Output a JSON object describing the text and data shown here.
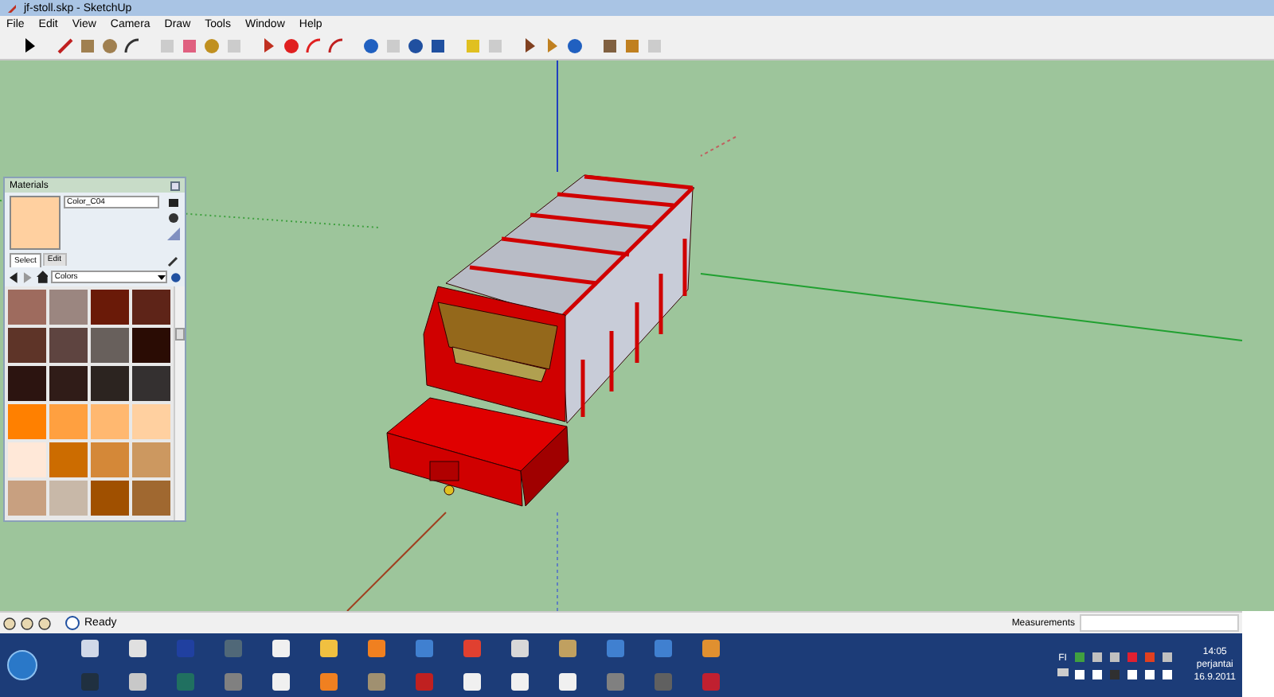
{
  "window": {
    "title": "jf-stoll.skp - SketchUp"
  },
  "menu": [
    "File",
    "Edit",
    "View",
    "Camera",
    "Draw",
    "Tools",
    "Window",
    "Help"
  ],
  "materials": {
    "title": "Materials",
    "material_name": "Color_C04",
    "tabs": [
      {
        "label": "Select",
        "selected": true
      },
      {
        "label": "Edit",
        "selected": false
      }
    ],
    "library": "Colors",
    "swatches": [
      {
        "color": "#9e6b5e"
      },
      {
        "color": "#9b8680"
      },
      {
        "color": "#6a1a08"
      },
      {
        "color": "#5e2418"
      },
      {
        "color": "#5e3428"
      },
      {
        "color": "#5e4440"
      },
      {
        "color": "#68605c"
      },
      {
        "color": "#2a0c04"
      },
      {
        "color": "#2c1410"
      },
      {
        "color": "#301c18"
      },
      {
        "color": "#2c2420"
      },
      {
        "color": "#343030"
      },
      {
        "color": "#ff8000"
      },
      {
        "color": "#ffa040"
      },
      {
        "color": "#ffb870"
      },
      {
        "color": "#ffd0a0"
      },
      {
        "color": "#ffe8d8"
      },
      {
        "color": "#cc6c00"
      },
      {
        "color": "#d48838"
      },
      {
        "color": "#cc9860"
      },
      {
        "color": "#c8a080"
      },
      {
        "color": "#c8b8a8"
      },
      {
        "color": "#a05000"
      },
      {
        "color": "#a06830"
      }
    ]
  },
  "status_bar": {
    "text": "Ready",
    "measurements_label": "Measurements"
  },
  "taskbar": {
    "language": "FI",
    "time": "14:05",
    "day": "perjantai",
    "date": "16.9.2011"
  }
}
